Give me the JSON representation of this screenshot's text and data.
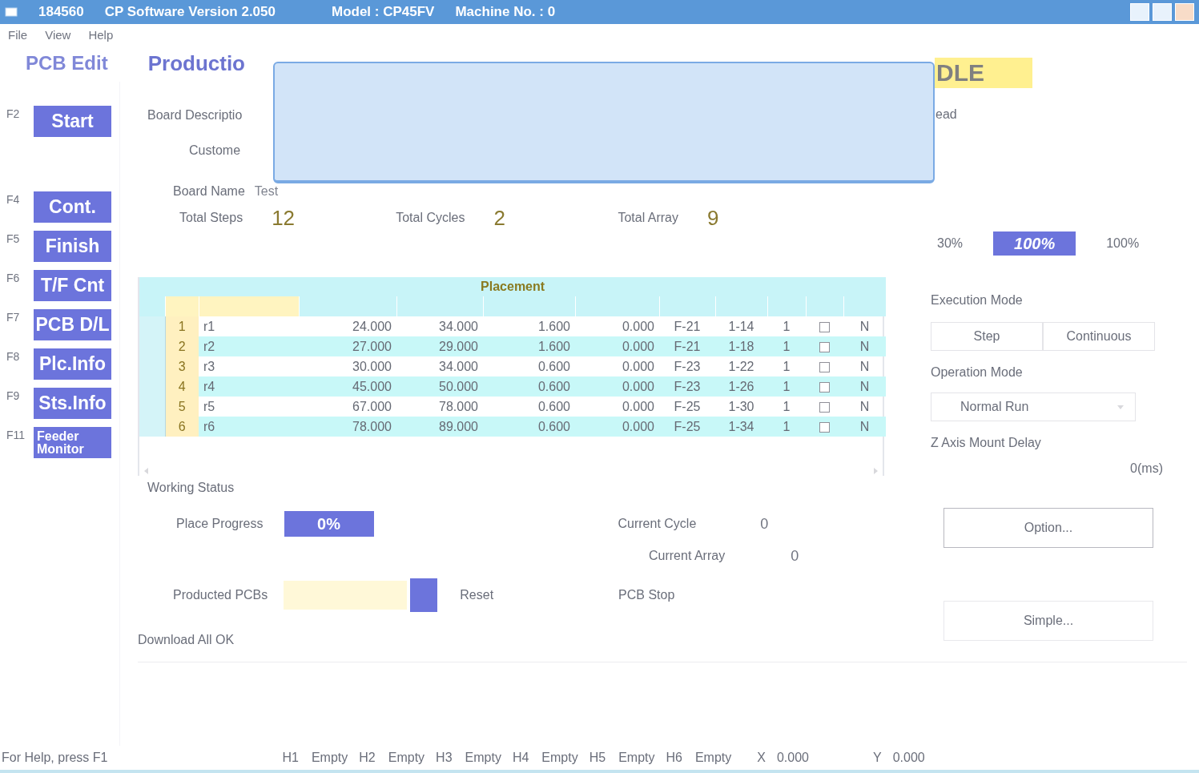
{
  "window": {
    "title_parts": [
      "184560",
      "CP Software Version 2.050",
      "Model : CP45FV",
      "Machine No. : 0"
    ]
  },
  "menu": [
    "File",
    "View",
    "Help"
  ],
  "sidebar": [
    {
      "key": "F2",
      "label": "Start"
    },
    {
      "key": "F4",
      "label": "Cont."
    },
    {
      "key": "F5",
      "label": "Finish"
    },
    {
      "key": "F6",
      "label": "T/F Cnt"
    },
    {
      "key": "F7",
      "label": "PCB D/L"
    },
    {
      "key": "F8",
      "label": "Plc.Info"
    },
    {
      "key": "F9",
      "label": "Sts.Info"
    },
    {
      "key": "F11",
      "label": "Feeder Monitor"
    }
  ],
  "tabs": [
    {
      "label": "PCB Edit",
      "selected": false
    },
    {
      "label": "Productio",
      "selected": true
    }
  ],
  "state_badge": "DLE",
  "board": {
    "description_label": "Board Descriptio",
    "customer_label": "Custome",
    "name_label": "Board Name",
    "name": "Test",
    "right_label": "ead"
  },
  "totals": [
    {
      "label": "Total Steps",
      "value": "12"
    },
    {
      "label": "Total Cycles",
      "value": "2"
    },
    {
      "label": "Total Array",
      "value": "9"
    }
  ],
  "speed": [
    {
      "label": "30%",
      "selected": false
    },
    {
      "label": "100%",
      "selected": true
    },
    {
      "label": "100%",
      "selected": false
    }
  ],
  "table": {
    "title": "Placement",
    "rows": [
      {
        "no": "1",
        "name": "r1",
        "cells": [
          "24.000",
          "34.000",
          "1.600",
          "0.000",
          "F-21",
          "1-14",
          "1"
        ],
        "checked": false,
        "flag": "N"
      },
      {
        "no": "2",
        "name": "r2",
        "cells": [
          "27.000",
          "29.000",
          "1.600",
          "0.000",
          "F-21",
          "1-18",
          "1"
        ],
        "checked": false,
        "flag": "N"
      },
      {
        "no": "3",
        "name": "r3",
        "cells": [
          "30.000",
          "34.000",
          "0.600",
          "0.000",
          "F-23",
          "1-22",
          "1"
        ],
        "checked": false,
        "flag": "N"
      },
      {
        "no": "4",
        "name": "r4",
        "cells": [
          "45.000",
          "50.000",
          "0.600",
          "0.000",
          "F-23",
          "1-26",
          "1"
        ],
        "checked": false,
        "flag": "N"
      },
      {
        "no": "5",
        "name": "r5",
        "cells": [
          "67.000",
          "78.000",
          "0.600",
          "0.000",
          "F-25",
          "1-30",
          "1"
        ],
        "checked": false,
        "flag": "N"
      },
      {
        "no": "6",
        "name": "r6",
        "cells": [
          "78.000",
          "89.000",
          "0.600",
          "0.000",
          "F-25",
          "1-34",
          "1"
        ],
        "checked": false,
        "flag": "N"
      }
    ]
  },
  "execution_mode": {
    "label": "Execution Mode",
    "options": [
      "Step",
      "Continuous"
    ]
  },
  "operation_mode": {
    "label": "Operation Mode",
    "value": "Normal Run"
  },
  "z_delay": {
    "label": "Z Axis Mount Delay",
    "reading": "0(ms)"
  },
  "side_buttons": [
    "Option...",
    "Simple..."
  ],
  "working_status": {
    "label": "Working Status",
    "progress_label": "Place Progress",
    "progress": "0%",
    "cycle_label": "Current Cycle",
    "cycle": "0",
    "array_label": "Current Array",
    "array": "0",
    "producted_label": "Producted PCBs",
    "reset": "Reset",
    "pcb_stop": "PCB Stop",
    "message": "Download All OK"
  },
  "status_bar": {
    "help": "For Help, press F1",
    "heads": [
      {
        "name": "H1",
        "state": "Empty"
      },
      {
        "name": "H2",
        "state": "Empty"
      },
      {
        "name": "H3",
        "state": "Empty"
      },
      {
        "name": "H4",
        "state": "Empty"
      },
      {
        "name": "H5",
        "state": "Empty"
      },
      {
        "name": "H6",
        "state": "Empty"
      }
    ],
    "x": {
      "label": "X",
      "value": "0.000"
    },
    "y": {
      "label": "Y",
      "value": "0.000"
    }
  }
}
